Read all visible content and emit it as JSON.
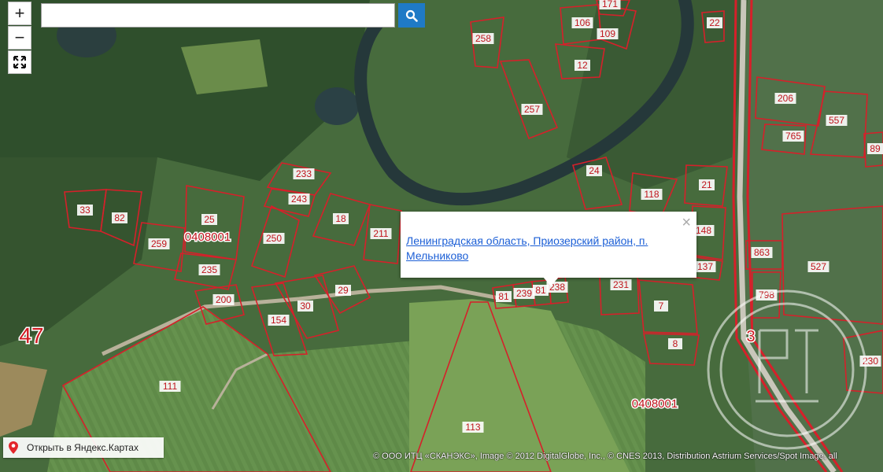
{
  "controls": {
    "zoom_in": "+",
    "zoom_out": "−",
    "fullscreen_icon": "expand-icon"
  },
  "search": {
    "placeholder": "",
    "button_icon": "search-icon"
  },
  "popup": {
    "address": "Ленинградская область, Приозерский район, п. Мельниково",
    "close": "×"
  },
  "open_in_yandex": {
    "label": "Открыть в Яндекс.Картах",
    "icon": "map-pin-icon"
  },
  "copyright": "© ООО ИТЦ «СКАНЭКС», Image © 2012 DigitalGlobe, Inc., © CNES 2013, Distribution Astrium Services/Spot Image, all",
  "map": {
    "cadastral_blocks": [
      "0408001",
      "0408001"
    ],
    "district_number": "47",
    "road_number": "3",
    "parcels": [
      "33",
      "82",
      "25",
      "259",
      "235",
      "200",
      "154",
      "30",
      "29",
      "250",
      "18",
      "211",
      "233",
      "243",
      "81",
      "239",
      "81",
      "238",
      "258",
      "106",
      "109",
      "171",
      "12",
      "257",
      "24",
      "118",
      "21",
      "148",
      "137",
      "231",
      "7",
      "8",
      "22",
      "206",
      "557",
      "765",
      "863",
      "527",
      "798",
      "230",
      "89",
      "111",
      "113"
    ]
  },
  "colors": {
    "parcel_border": "#d6202a",
    "label_bg": "#ffffff",
    "label_text": "#c0141c",
    "link": "#1c5fd6",
    "search_button": "#1f7ac6"
  }
}
